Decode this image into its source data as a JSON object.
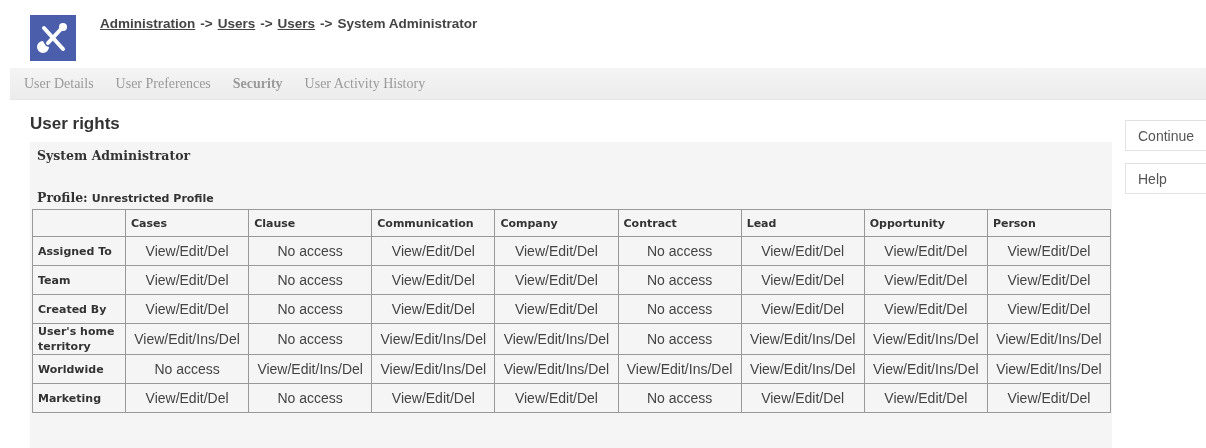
{
  "breadcrumb_separator": "->",
  "breadcrumb": [
    {
      "label": "Administration",
      "link": true
    },
    {
      "label": "Users",
      "link": true
    },
    {
      "label": "Users",
      "link": true
    },
    {
      "label": "System Administrator",
      "link": false
    }
  ],
  "tabs": [
    {
      "label": "User Details",
      "selected": false
    },
    {
      "label": "User Preferences",
      "selected": false
    },
    {
      "label": "Security",
      "selected": true
    },
    {
      "label": "User Activity History",
      "selected": false
    }
  ],
  "title": "User rights",
  "panel": {
    "user": "System Administrator",
    "profile_label": "Profile:",
    "profile": "Unrestricted Profile"
  },
  "table": {
    "columns": [
      "Cases",
      "Clause",
      "Communication",
      "Company",
      "Contract",
      "Lead",
      "Opportunity",
      "Person"
    ],
    "rows": [
      {
        "label": "Assigned To",
        "cells": [
          "View/Edit/Del",
          "No access",
          "View/Edit/Del",
          "View/Edit/Del",
          "No access",
          "View/Edit/Del",
          "View/Edit/Del",
          "View/Edit/Del"
        ]
      },
      {
        "label": "Team",
        "cells": [
          "View/Edit/Del",
          "No access",
          "View/Edit/Del",
          "View/Edit/Del",
          "No access",
          "View/Edit/Del",
          "View/Edit/Del",
          "View/Edit/Del"
        ]
      },
      {
        "label": "Created By",
        "cells": [
          "View/Edit/Del",
          "No access",
          "View/Edit/Del",
          "View/Edit/Del",
          "No access",
          "View/Edit/Del",
          "View/Edit/Del",
          "View/Edit/Del"
        ]
      },
      {
        "label": "User's home territory",
        "cells": [
          "View/Edit/Ins/Del",
          "No access",
          "View/Edit/Ins/Del",
          "View/Edit/Ins/Del",
          "No access",
          "View/Edit/Ins/Del",
          "View/Edit/Ins/Del",
          "View/Edit/Ins/Del"
        ]
      },
      {
        "label": "Worldwide",
        "cells": [
          "No access",
          "View/Edit/Ins/Del",
          "View/Edit/Ins/Del",
          "View/Edit/Ins/Del",
          "View/Edit/Ins/Del",
          "View/Edit/Ins/Del",
          "View/Edit/Ins/Del",
          "View/Edit/Ins/Del"
        ]
      },
      {
        "label": "Marketing",
        "cells": [
          "View/Edit/Del",
          "No access",
          "View/Edit/Del",
          "View/Edit/Del",
          "No access",
          "View/Edit/Del",
          "View/Edit/Del",
          "View/Edit/Del"
        ]
      }
    ]
  },
  "buttons": [
    "Continue",
    "Help"
  ]
}
